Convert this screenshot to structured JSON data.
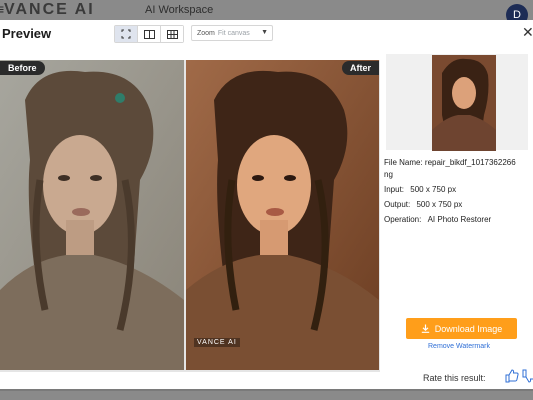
{
  "app": {
    "menu_mark": "≡",
    "logo": "VANCE AI",
    "workspace": "AI Workspace",
    "avatar": "D"
  },
  "modal": {
    "title": "Preview",
    "zoom_label": "Zoom",
    "zoom_value": "Fit canvas",
    "view_modes": [
      "split-view-icon",
      "side-by-side-icon",
      "grid-view-icon"
    ],
    "before_label": "Before",
    "after_label": "After",
    "watermark": "VANCE AI"
  },
  "file": {
    "name_label": "File Name:",
    "name_value": "repair_bikdf_1017362266",
    "name_value_cont": "ng",
    "input_label": "Input:",
    "input_value": "500 x 750 px",
    "output_label": "Output:",
    "output_value": "500 x 750 px",
    "operation_label": "Operation:",
    "operation_value": "AI Photo Restorer"
  },
  "actions": {
    "download": "Download Image",
    "remove_watermark": "Remove Watermark",
    "rate": "Rate this result:"
  },
  "colors": {
    "accent": "#ff9e1a",
    "link": "#2f6fd6",
    "tag_bg": "#2b2b2b"
  }
}
